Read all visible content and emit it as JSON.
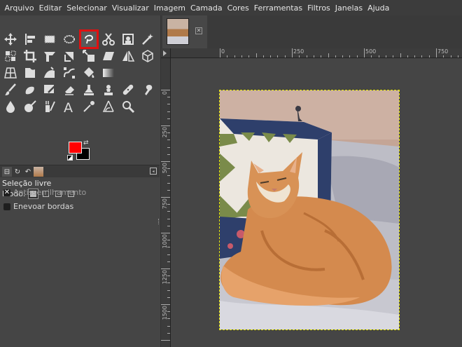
{
  "menubar": {
    "items": [
      "Arquivo",
      "Editar",
      "Selecionar",
      "Visualizar",
      "Imagem",
      "Camada",
      "Cores",
      "Ferramentas",
      "Filtros",
      "Janelas",
      "Ajuda"
    ]
  },
  "toolbox": {
    "active_tool": "free-select-tool",
    "foreground_color": "#ff0000",
    "background_color": "#000000"
  },
  "tool_options": {
    "title": "Seleção livre",
    "mode_label": "Modo:",
    "antialiasing_label": "Antisserrilhamento",
    "antialiasing_checked": true,
    "feather_label": "Enevoar bordas",
    "feather_checked": false
  },
  "ruler": {
    "h_labels": [
      "0",
      "250",
      "500",
      "750"
    ],
    "v_labels": [
      "0",
      "250",
      "500",
      "750",
      "1000",
      "1250",
      "1500"
    ]
  },
  "colors": {
    "selection_outline": "#e6e600",
    "active_tool_highlight": "#e01010"
  }
}
